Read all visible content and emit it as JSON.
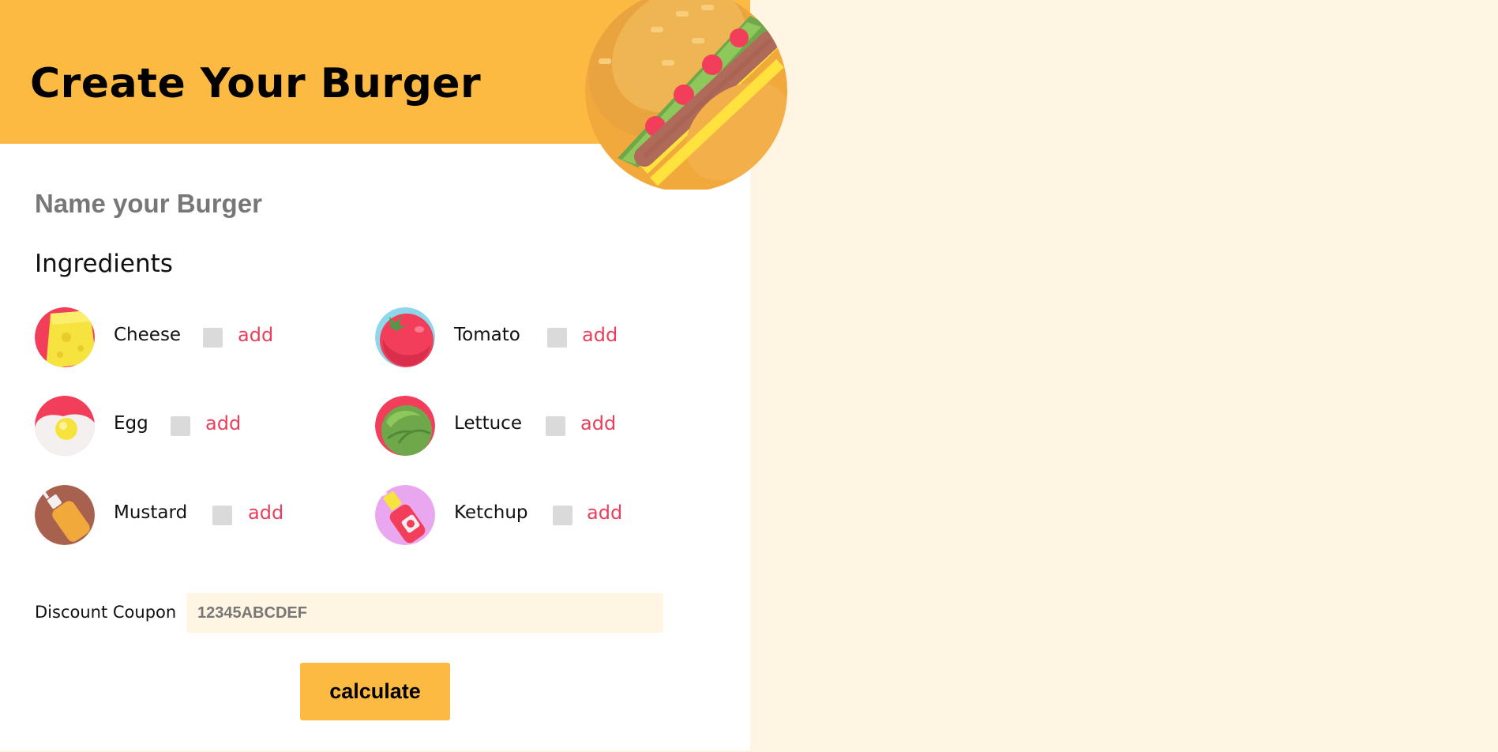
{
  "header": {
    "title": "Create Your Burger"
  },
  "form": {
    "name_placeholder": "Name your Burger",
    "ingredients_heading": "Ingredients",
    "ingredients": [
      {
        "label": "Cheese",
        "add_label": "add",
        "icon": "cheese-icon"
      },
      {
        "label": "Tomato",
        "add_label": "add",
        "icon": "tomato-icon"
      },
      {
        "label": "Egg",
        "add_label": "add",
        "icon": "egg-icon"
      },
      {
        "label": "Lettuce",
        "add_label": "add",
        "icon": "lettuce-icon"
      },
      {
        "label": "Mustard",
        "add_label": "add",
        "icon": "mustard-icon"
      },
      {
        "label": "Ketchup",
        "add_label": "add",
        "icon": "ketchup-icon"
      }
    ],
    "coupon_label": "Discount Coupon",
    "coupon_placeholder": "12345ABCDEF",
    "calculate_label": "calculate"
  },
  "colors": {
    "accent": "#fdba43",
    "add_link": "#e8405c",
    "right_panel": "#fff5e2"
  }
}
